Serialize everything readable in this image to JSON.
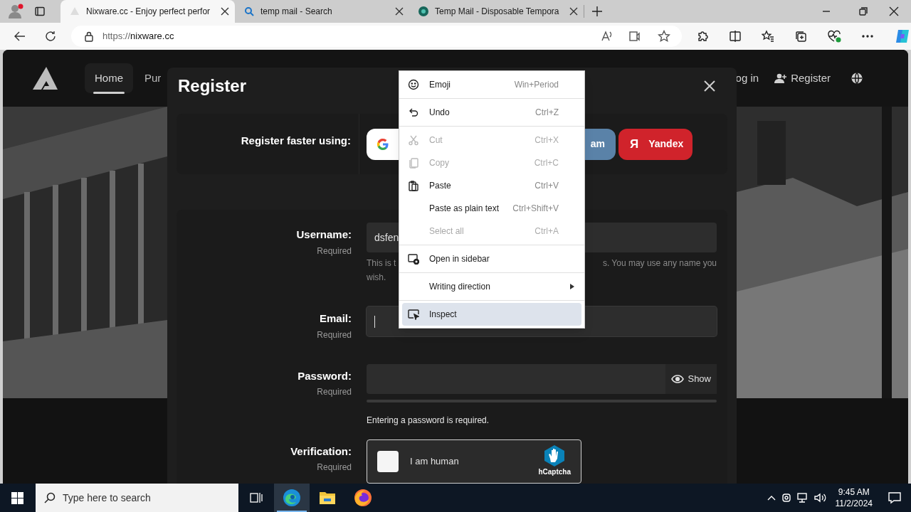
{
  "browser": {
    "tabs": [
      {
        "title": "Nixware.cc - Enjoy perfect perfor",
        "selected": true,
        "kind": "site"
      },
      {
        "title": "temp mail - Search",
        "selected": false,
        "kind": "search"
      },
      {
        "title": "Temp Mail - Disposable Tempora",
        "selected": false,
        "kind": "mail"
      }
    ],
    "url_scheme": "https://",
    "url_host": "nixware.cc"
  },
  "site_nav": {
    "items": [
      {
        "label": "Home",
        "selected": true
      },
      {
        "label": "Pur",
        "selected": false
      }
    ],
    "login": "og in",
    "register": "Register"
  },
  "modal": {
    "title": "Register",
    "social_label": "Register faster using:",
    "social_buttons": [
      {
        "kind": "google"
      },
      {
        "kind": "steam",
        "label": "am"
      },
      {
        "kind": "yandex",
        "label": "Yandex",
        "icon": "Я"
      }
    ],
    "fields": [
      {
        "kind": "text",
        "label": "Username:",
        "note": "Required",
        "value": "dsfen",
        "focused": false,
        "hint_start": "This is t",
        "hint_end": "s. You may use any name you",
        "hint_wrap": "wish."
      },
      {
        "kind": "text",
        "label": "Email:",
        "note": "Required",
        "focused": true
      },
      {
        "kind": "password",
        "label": "Password:",
        "note": "Required",
        "focused": false,
        "toggle": "Show",
        "message": "Entering a password is required."
      },
      {
        "kind": "captcha",
        "label": "Verification:",
        "note": "Required",
        "checkbox_label": "I am human",
        "checked": false,
        "brand": "hCaptcha"
      }
    ]
  },
  "context_menu": {
    "groups": [
      [
        {
          "label": "Emoji",
          "shortcut": "Win+Period",
          "disabled": false,
          "selected": false,
          "submenu": false
        }
      ],
      [
        {
          "label": "Undo",
          "shortcut": "Ctrl+Z",
          "disabled": false,
          "selected": false,
          "submenu": false
        }
      ],
      [
        {
          "label": "Cut",
          "shortcut": "Ctrl+X",
          "disabled": true,
          "selected": false,
          "submenu": false
        },
        {
          "label": "Copy",
          "shortcut": "Ctrl+C",
          "disabled": true,
          "selected": false,
          "submenu": false
        },
        {
          "label": "Paste",
          "shortcut": "Ctrl+V",
          "disabled": false,
          "selected": false,
          "submenu": false
        },
        {
          "label": "Paste as plain text",
          "shortcut": "Ctrl+Shift+V",
          "disabled": false,
          "selected": false,
          "submenu": false
        },
        {
          "label": "Select all",
          "shortcut": "Ctrl+A",
          "disabled": true,
          "selected": false,
          "submenu": false
        }
      ],
      [
        {
          "label": "Open in sidebar",
          "disabled": false,
          "selected": false,
          "submenu": false
        }
      ],
      [
        {
          "label": "Writing direction",
          "disabled": false,
          "selected": false,
          "submenu": true
        }
      ],
      [
        {
          "label": "Inspect",
          "disabled": false,
          "selected": true,
          "submenu": false
        }
      ]
    ]
  },
  "taskbar": {
    "search_placeholder": "Type here to search",
    "apps": [
      {
        "kind": "taskview",
        "selected": false
      },
      {
        "kind": "edge",
        "selected": true
      },
      {
        "kind": "explorer",
        "selected": false
      },
      {
        "kind": "firefox",
        "selected": false
      }
    ],
    "time": "9:45 AM",
    "date": "11/2/2024"
  }
}
